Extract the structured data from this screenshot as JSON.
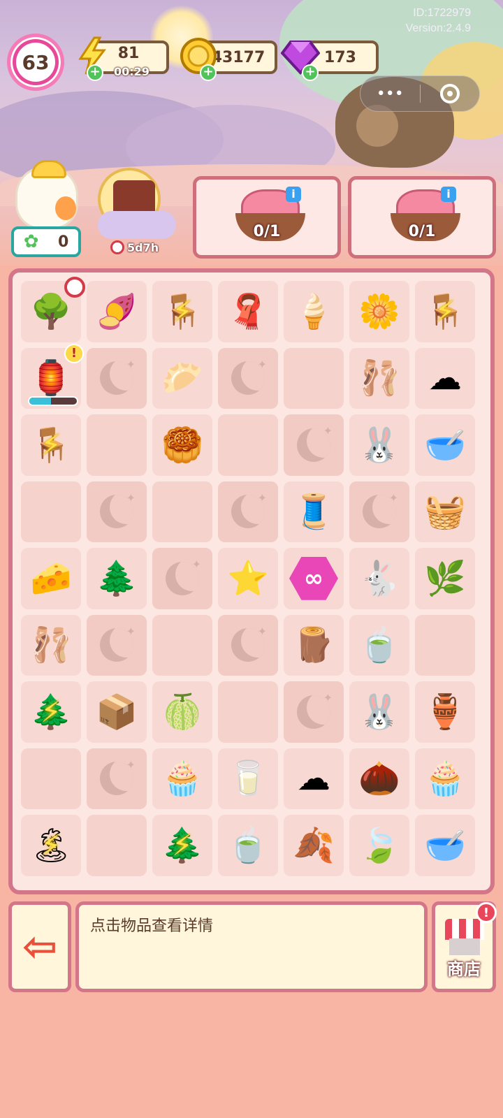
{
  "header": {
    "id_text": "ID:1722979",
    "version_text": "Version:2.4.9"
  },
  "hud": {
    "level": "63",
    "energy": {
      "value": "81",
      "timer": "00:29",
      "icon": "lightning-icon"
    },
    "coins": {
      "value": "43177",
      "icon": "coin-icon"
    },
    "gems": {
      "value": "173",
      "icon": "gem-icon"
    },
    "plus_symbol": "+"
  },
  "capsule": {
    "menu_label": "•••",
    "close_icon": "target-icon"
  },
  "character": {
    "counter_icon": "clover-icon",
    "counter_value": "0"
  },
  "event": {
    "timer": "5d7h"
  },
  "orders": [
    {
      "progress": "0/1",
      "info": "i",
      "icon": "mooncake-order-icon"
    },
    {
      "progress": "0/1",
      "info": "i",
      "icon": "mooncake-order-icon"
    }
  ],
  "board": {
    "rows": [
      [
        "tree-icon",
        "taro-cake-icon",
        "loom-icon",
        "purple-cloth-icon",
        "spindle-icon",
        "osmanthus-flower-icon",
        "loom-icon"
      ],
      [
        "red-pavilion-icon",
        "moon-lock",
        "bun-plate-icon",
        "moon-lock",
        "empty",
        "pink-slippers-icon",
        "white-cloud-icon"
      ],
      [
        "loom-icon",
        "empty",
        "mooncake-icon",
        "empty",
        "moon-lock",
        "rabbit-cook-icon",
        "jade-bowl-icon"
      ],
      [
        "empty",
        "moon-lock",
        "empty",
        "moon-lock",
        "thread-spool-icon",
        "moon-lock",
        "star-basket-icon"
      ],
      [
        "cheese-cake-icon",
        "blue-pine-icon",
        "moon-lock",
        "star-icon",
        "infinity-hex-icon",
        "rabbit-baker-icon",
        "osmanthus-branch-icon"
      ],
      [
        "pink-slippers-icon",
        "moon-lock",
        "empty",
        "moon-lock",
        "wood-pile-icon",
        "tea-cup-icon",
        "empty"
      ],
      [
        "blue-tree-icon",
        "star-chest-icon",
        "green-cake-icon",
        "empty",
        "moon-lock",
        "bunny-mixer-icon",
        "lantern-jar-icon"
      ],
      [
        "empty",
        "moon-lock",
        "cupcake-icon",
        "blue-cup-icon",
        "white-cloud-icon",
        "acorn-icon",
        "cupcake-icon"
      ],
      [
        "island-tree-icon",
        "empty",
        "blue-tree-icon",
        "tea-cup-icon",
        "ginkgo-leaf-icon",
        "leaf-plate-icon",
        "jade-bowl-icon"
      ]
    ],
    "glyphs": {
      "tree-icon": "🌳",
      "taro-cake-icon": "🍠",
      "loom-icon": "🪑",
      "purple-cloth-icon": "🧣",
      "spindle-icon": "🍦",
      "osmanthus-flower-icon": "🌼",
      "red-pavilion-icon": "🏮",
      "bun-plate-icon": "🥟",
      "pink-slippers-icon": "🩰",
      "white-cloud-icon": "☁",
      "mooncake-icon": "🥮",
      "rabbit-cook-icon": "🐰",
      "jade-bowl-icon": "🥣",
      "thread-spool-icon": "🧵",
      "star-basket-icon": "🧺",
      "cheese-cake-icon": "🧀",
      "blue-pine-icon": "🌲",
      "star-icon": "⭐",
      "infinity-hex-icon": "∞",
      "rabbit-baker-icon": "🐇",
      "osmanthus-branch-icon": "🌿",
      "wood-pile-icon": "🪵",
      "tea-cup-icon": "🍵",
      "blue-tree-icon": "🌲",
      "star-chest-icon": "📦",
      "green-cake-icon": "🍈",
      "bunny-mixer-icon": "🐰",
      "lantern-jar-icon": "🏺",
      "cupcake-icon": "🧁",
      "blue-cup-icon": "🥛",
      "acorn-icon": "🌰",
      "island-tree-icon": "🏝",
      "ginkgo-leaf-icon": "🍂",
      "leaf-plate-icon": "🍃"
    },
    "bolt_cells": [
      [
        0,
        2
      ],
      [
        0,
        6
      ],
      [
        2,
        0
      ],
      [
        6,
        0
      ],
      [
        8,
        0
      ],
      [
        8,
        2
      ]
    ],
    "pavilion_progress": 0.45
  },
  "bottom": {
    "info_text": "点击物品查看详情",
    "shop_label": "商店",
    "shop_alert": "!",
    "exit_icon": "exit-door-icon"
  }
}
